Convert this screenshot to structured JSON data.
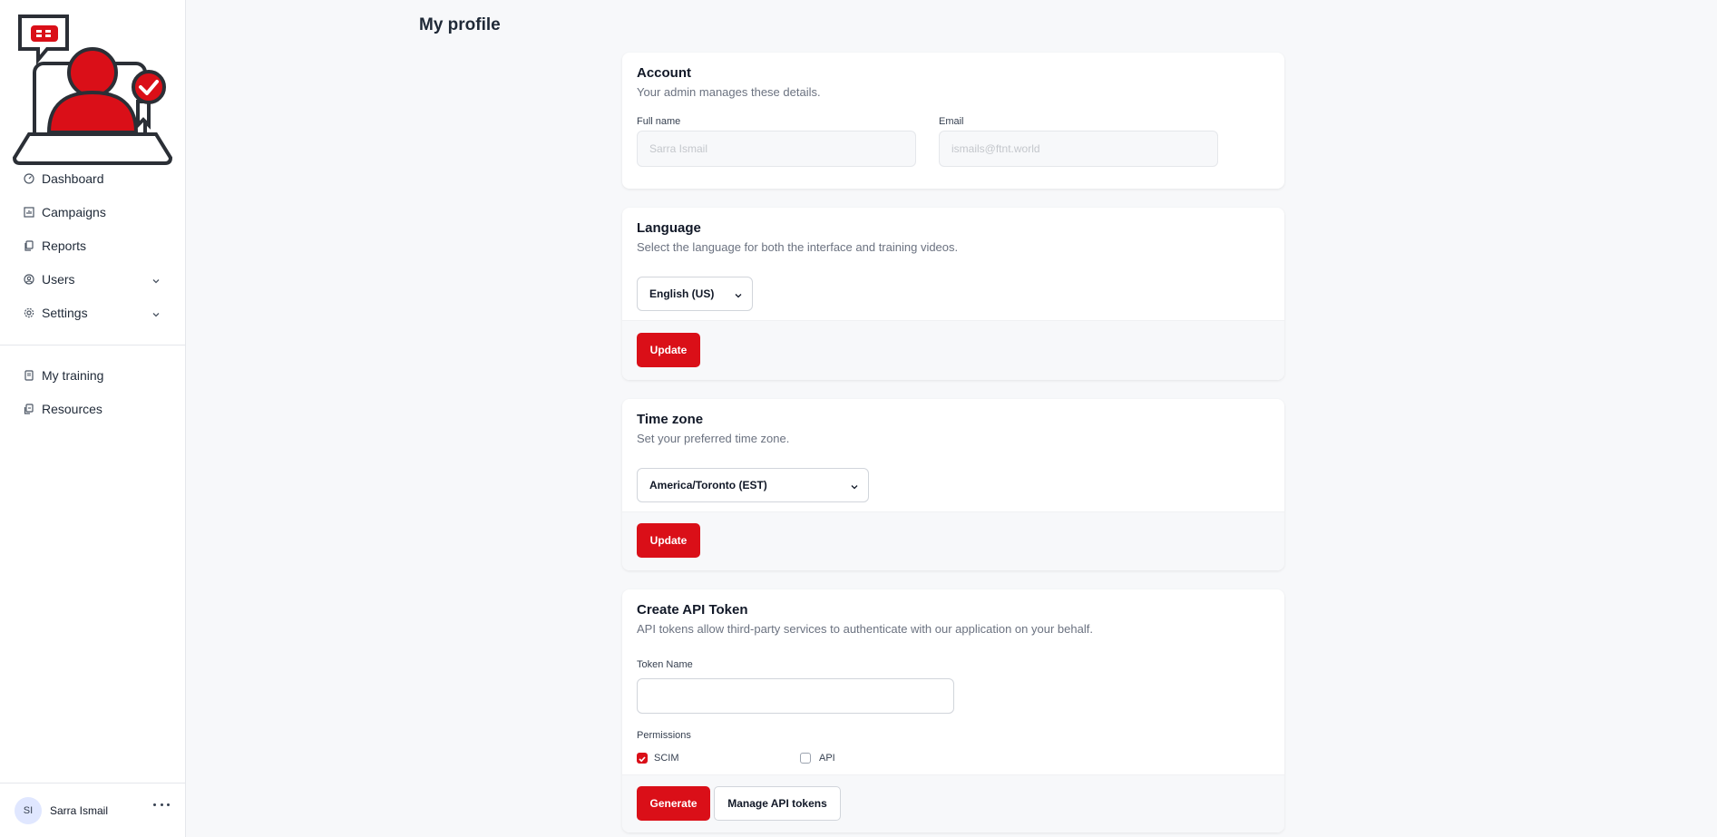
{
  "sidebar": {
    "nav": [
      {
        "label": "Dashboard",
        "icon": "dashboard-icon"
      },
      {
        "label": "Campaigns",
        "icon": "campaigns-icon"
      },
      {
        "label": "Reports",
        "icon": "reports-icon"
      },
      {
        "label": "Users",
        "icon": "users-icon"
      },
      {
        "label": "Settings",
        "icon": "settings-icon"
      }
    ],
    "secondary": [
      {
        "label": "My training",
        "icon": "training-icon"
      },
      {
        "label": "Resources",
        "icon": "resources-icon"
      }
    ],
    "user": {
      "initials": "SI",
      "name": "Sarra Ismail"
    }
  },
  "page": {
    "title": "My profile"
  },
  "account": {
    "title": "Account",
    "description": "Your admin manages these details.",
    "full_name_label": "Full name",
    "full_name_value": "Sarra Ismail",
    "email_label": "Email",
    "email_value": "ismails@ftnt.world"
  },
  "language": {
    "title": "Language",
    "description": "Select the language for both the interface and training videos.",
    "selected": "English (US)",
    "button": "Update"
  },
  "timezone": {
    "title": "Time zone",
    "description": "Set your preferred time zone.",
    "selected": "America/Toronto (EST)",
    "button": "Update"
  },
  "api_token": {
    "title": "Create API Token",
    "description": "API tokens allow third-party services to authenticate with our application on your behalf.",
    "token_name_label": "Token Name",
    "token_name_value": "",
    "permissions_label": "Permissions",
    "permissions": [
      {
        "label": "SCIM",
        "checked": true
      },
      {
        "label": "API",
        "checked": false
      }
    ],
    "generate_button": "Generate",
    "manage_button": "Manage API tokens"
  },
  "colors": {
    "accent": "#da0f18",
    "background": "#f7f8fa"
  }
}
